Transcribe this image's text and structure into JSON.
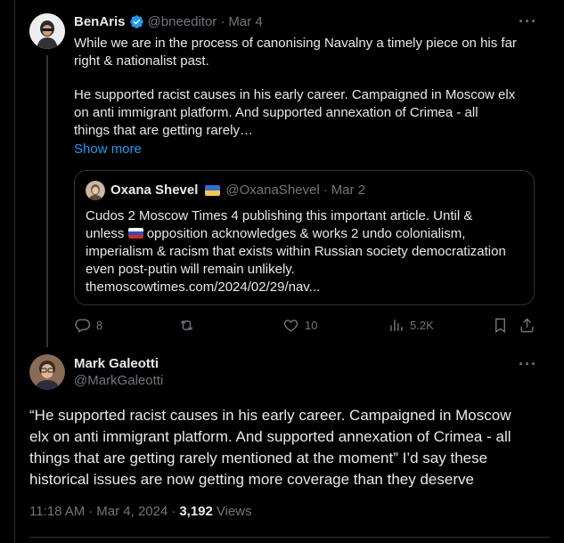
{
  "tweet1": {
    "author_name": "BenAris",
    "handle": "@bneeditor",
    "sep": "·",
    "date": "Mar 4",
    "line1": "While we are in the process of canonising Navalny a timely piece on his far",
    "line2": "right & nationalist past.",
    "line3": "He supported racist causes in his early career. Campaigned in Moscow elx",
    "line4": "on anti immigrant platform. And supported annexation of Crimea - all",
    "line5": "things that are getting rarely…",
    "show_more": "Show more",
    "quote": {
      "author_name": "Oxana Shevel",
      "handle": "@OxanaShevel",
      "sep": "·",
      "date": "Mar 2",
      "line1": "Cudos 2 Moscow Times 4 publishing this important article. Until &",
      "line2a": "unless",
      "line2b": "opposition acknowledges & works 2 undo colonialism,",
      "line3": "imperialism & racism that exists within Russian society democratization",
      "line4": "even post-putin will remain unlikely.",
      "line5": "themoscowtimes.com/2024/02/29/nav..."
    },
    "actions": {
      "replies": "8",
      "likes": "10",
      "views": "5.2K"
    }
  },
  "tweet2": {
    "author_name": "Mark Galeotti",
    "handle": "@MarkGaleotti",
    "line1": "“He supported racist causes in his early career. Campaigned in Moscow",
    "line2": "elx on anti immigrant platform. And supported annexation of Crimea - all",
    "line3": "things that are getting rarely mentioned at the moment” I’d say these",
    "line4": "historical issues are now getting more coverage than they deserve",
    "time": "11:18 AM",
    "sep": "·",
    "date": "Mar 4, 2024",
    "sep2": "·",
    "views_count": "3,192",
    "views_label": "Views"
  },
  "colors": {
    "background": "#000000",
    "text": "#e7e9ea",
    "muted": "#71767b",
    "accent": "#1d9bf0",
    "border": "#2f3336"
  }
}
